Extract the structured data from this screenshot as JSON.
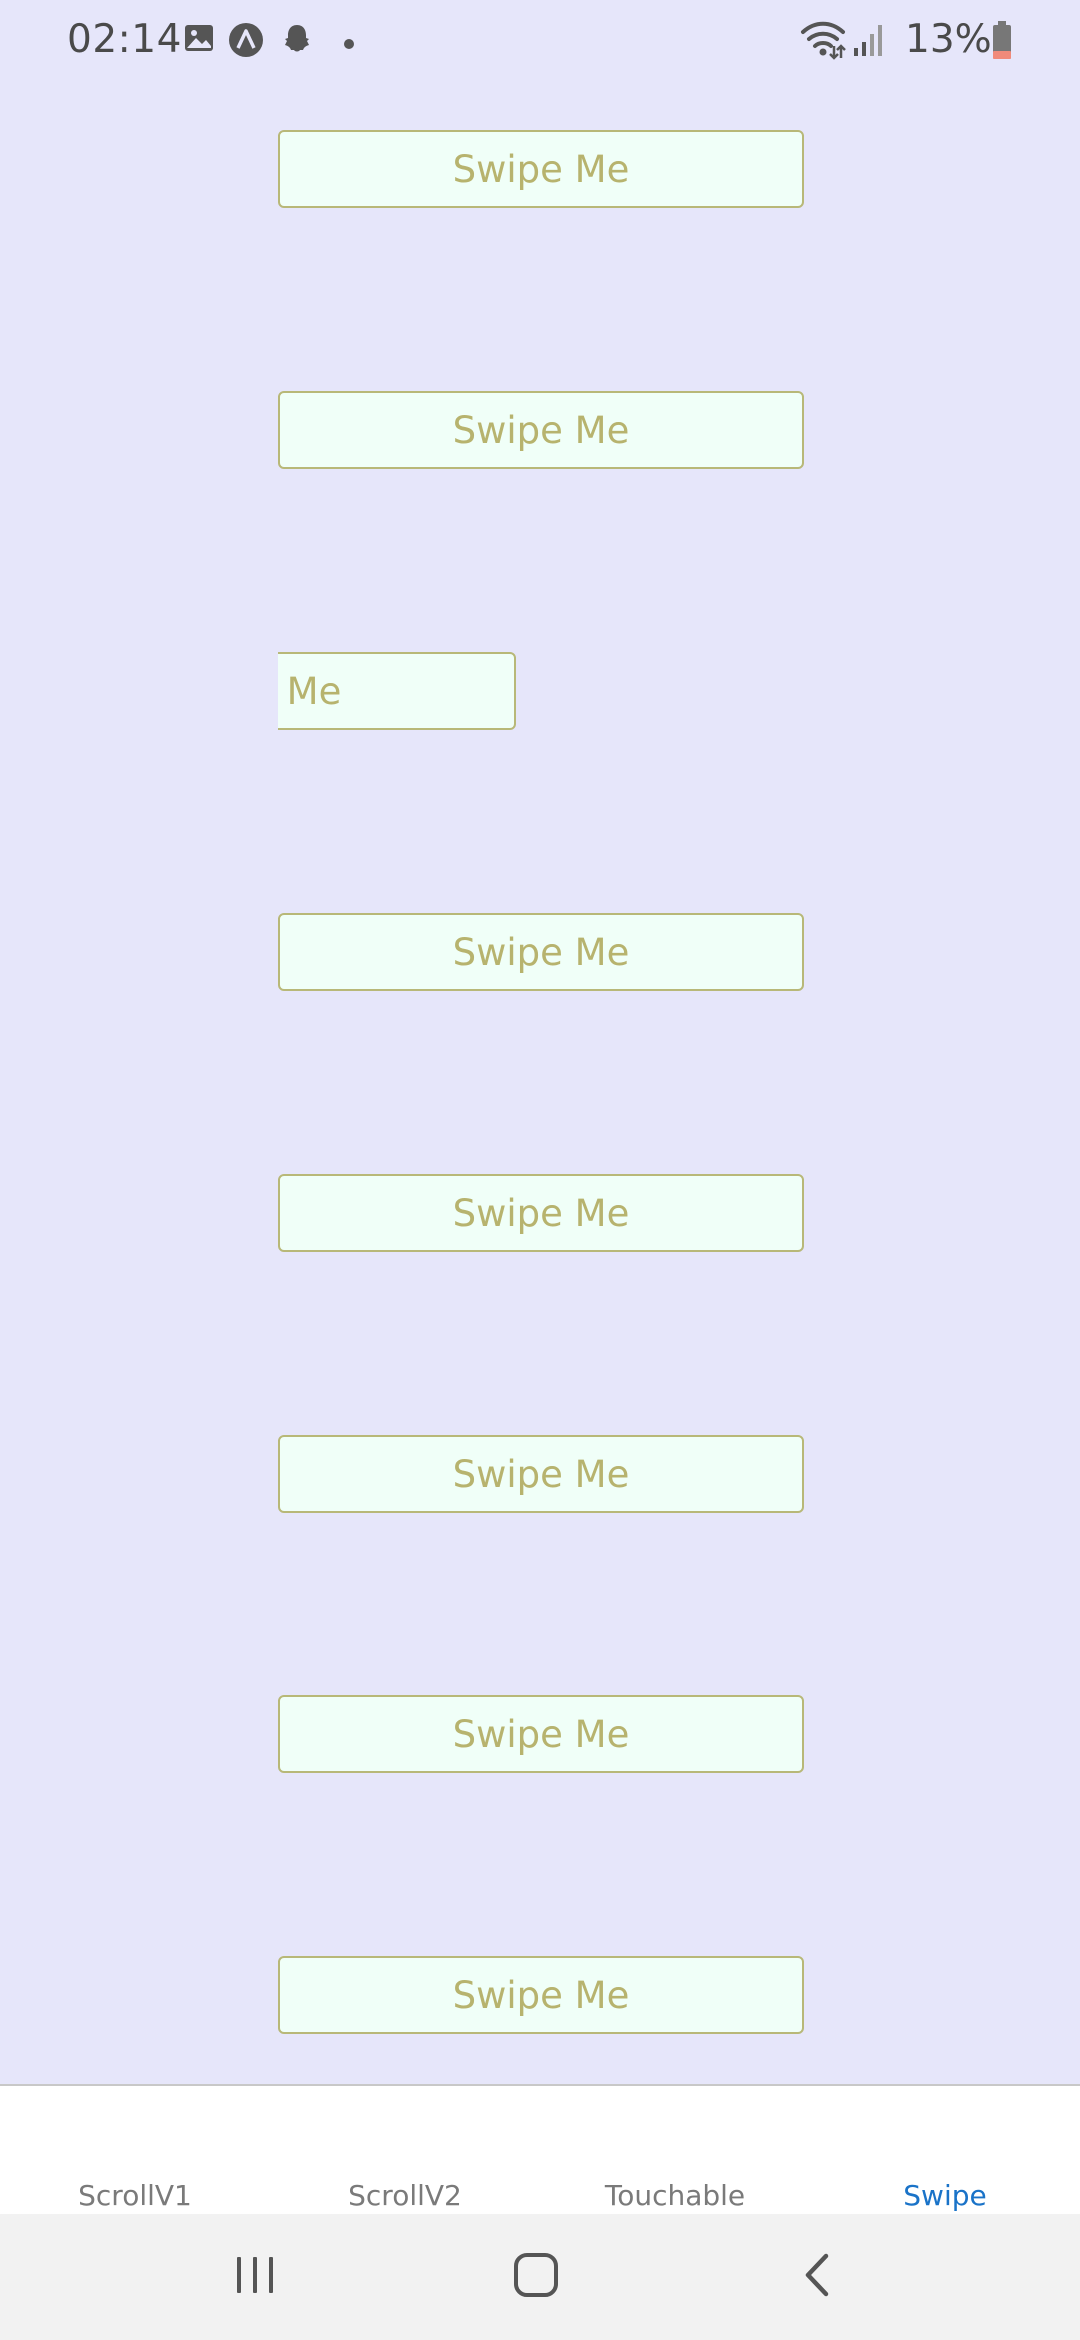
{
  "status_bar": {
    "time": "02:14",
    "notification_icons": [
      "image-icon",
      "app-a-icon",
      "snapchat-icon",
      "dot-icon"
    ],
    "battery_percent": "13%",
    "battery_color": "#f08a7a"
  },
  "swipe_list": {
    "items": [
      {
        "label": "Swipe Me"
      },
      {
        "label": "Swipe Me"
      },
      {
        "label": "Swipe Me"
      },
      {
        "label": "Swipe Me"
      },
      {
        "label": "Swipe Me"
      },
      {
        "label": "Swipe Me"
      },
      {
        "label": "Swipe Me"
      },
      {
        "label": "Swipe Me"
      }
    ]
  },
  "tab_bar": {
    "tabs": [
      {
        "label": "ScrollV1",
        "active": false
      },
      {
        "label": "ScrollV2",
        "active": false
      },
      {
        "label": "Touchable",
        "active": false
      },
      {
        "label": "Swipe",
        "active": true
      }
    ],
    "active_color": "#1a73c8"
  },
  "nav_bar": {
    "buttons": [
      "recents-icon",
      "home-icon",
      "back-icon"
    ]
  },
  "colors": {
    "background": "#e6e6fa",
    "button_fill": "#f0fff8",
    "button_border": "#b8b878",
    "button_text": "#b7b36e"
  }
}
